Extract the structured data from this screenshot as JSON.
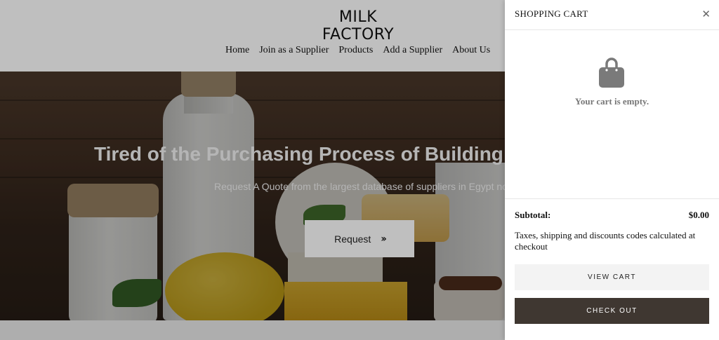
{
  "site": {
    "logo": "MILK FACTORY",
    "nav": [
      "Home",
      "Join as a Supplier",
      "Products",
      "Add a Supplier",
      "About Us"
    ]
  },
  "hero": {
    "title": "Tired of the Purchasing Process of Building Mate",
    "subtitle": "Request A Quote from the largest database of suppliers in Egypt now",
    "button_label": "Request",
    "button_icon": "double-chevron-right-icon"
  },
  "cart": {
    "title": "SHOPPING CART",
    "close_icon": "close-icon",
    "empty_icon": "shopping-bag-icon",
    "empty_text": "Your cart is empty.",
    "subtotal_label": "Subtotal:",
    "subtotal_value": "$0.00",
    "tax_note": "Taxes, shipping and discounts codes calculated at checkout",
    "view_cart_label": "VIEW CART",
    "checkout_label": "CHECK OUT"
  },
  "colors": {
    "checkout_bg": "#3f3731",
    "view_cart_bg": "#f3f3f3"
  }
}
